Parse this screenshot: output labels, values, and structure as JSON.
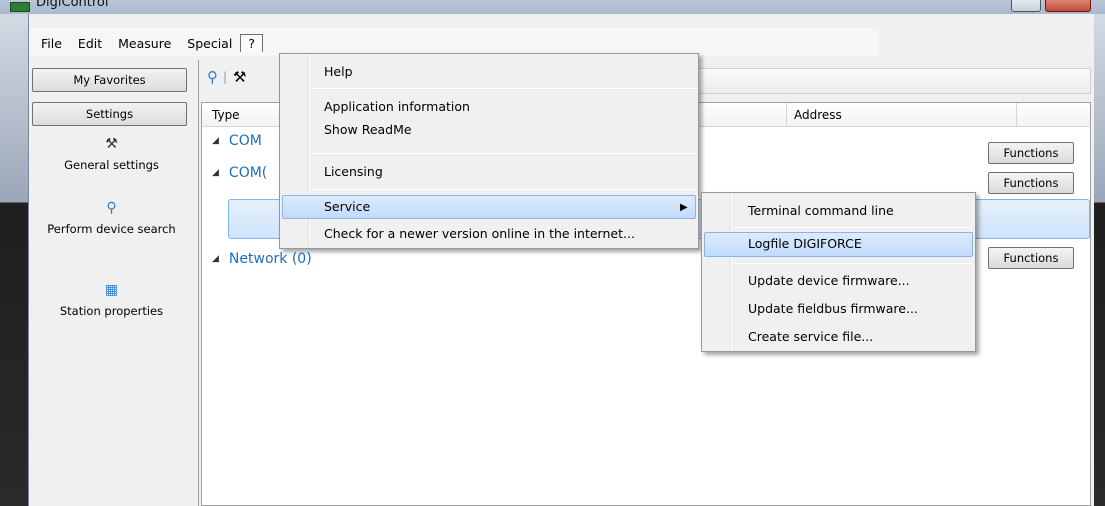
{
  "window": {
    "title": "DigiControl"
  },
  "menubar": {
    "items": [
      "File",
      "Edit",
      "Measure",
      "Special",
      "?"
    ]
  },
  "left_panel": {
    "favorites_button": "My Favorites",
    "settings_button": "Settings",
    "nav": [
      {
        "label": "General settings",
        "icon": "wrench-icon"
      },
      {
        "label": "Perform device search",
        "icon": "magnifier-icon"
      },
      {
        "label": "Station properties",
        "icon": "properties-icon"
      }
    ]
  },
  "grid": {
    "columns": {
      "type": "Type",
      "address": "Address"
    },
    "rows": [
      {
        "label": "COM"
      },
      {
        "label": "COM("
      },
      {
        "label": "Network (0)"
      }
    ],
    "functions_button": "Functions"
  },
  "help_menu": {
    "items": [
      "Help",
      "Application information",
      "Show ReadMe",
      "Licensing",
      "Service",
      "Check for a newer version online in the internet..."
    ]
  },
  "service_submenu": {
    "items": [
      "Terminal command line",
      "Logfile DIGIFORCE",
      "Update device firmware...",
      "Update fieldbus firmware...",
      "Create service file..."
    ]
  }
}
